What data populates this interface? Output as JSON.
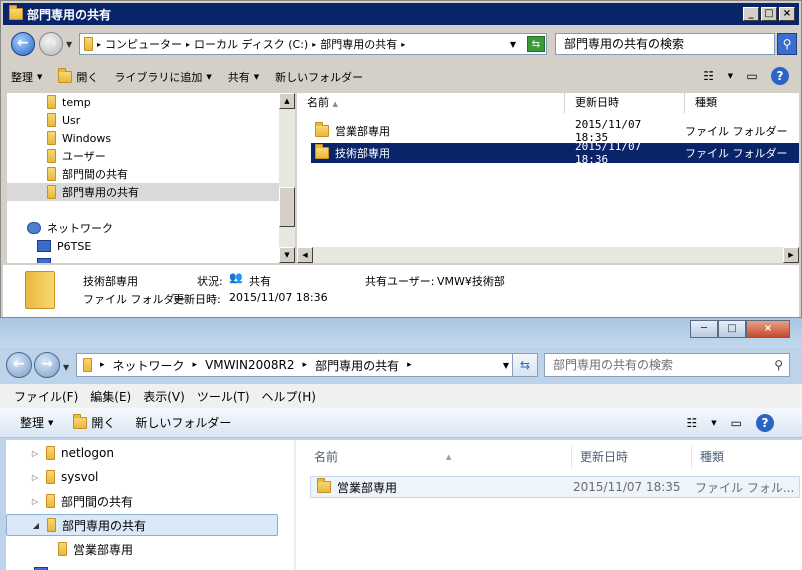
{
  "win1": {
    "title": "部門専用の共有",
    "controls": [
      "_",
      "□",
      "×"
    ],
    "address": {
      "crumbs": [
        "コンピューター",
        "ローカル ディスク (C:)",
        "部門専用の共有"
      ],
      "search_placeholder": "部門専用の共有の検索"
    },
    "toolbar": {
      "organize": "整理",
      "open": "開く",
      "add_library": "ライブラリに追加",
      "share": "共有",
      "new_folder": "新しいフォルダー"
    },
    "nav": [
      {
        "label": "temp"
      },
      {
        "label": "Usr"
      },
      {
        "label": "Windows"
      },
      {
        "label": "ユーザー"
      },
      {
        "label": "部門間の共有"
      },
      {
        "label": "部門専用の共有"
      },
      {
        "label": "ネットワーク"
      },
      {
        "label": "P6TSE"
      }
    ],
    "columns": [
      "名前",
      "更新日時",
      "種類"
    ],
    "rows": [
      {
        "name": "営業部専用",
        "date": "2015/11/07 18:35",
        "type": "ファイル フォルダー"
      },
      {
        "name": "技術部専用",
        "date": "2015/11/07 18:36",
        "type": "ファイル フォルダー"
      }
    ],
    "details": {
      "name": "技術部専用",
      "type": "ファイル フォルダー",
      "status_label": "状況:",
      "status_value": "共有",
      "shared_label": "共有ユーザー:",
      "shared_value": "VMW¥技術部",
      "date_label": "更新日時:",
      "date_value": "2015/11/07 18:36"
    }
  },
  "win2": {
    "controls": [
      "─",
      "□",
      "×"
    ],
    "address": {
      "crumbs": [
        "ネットワーク",
        "VMWIN2008R2",
        "部門専用の共有"
      ],
      "search_placeholder": "部門専用の共有の検索"
    },
    "menu": [
      "ファイル(F)",
      "編集(E)",
      "表示(V)",
      "ツール(T)",
      "ヘルプ(H)"
    ],
    "toolbar": {
      "organize": "整理",
      "open": "開く",
      "new_folder": "新しいフォルダー"
    },
    "nav": [
      {
        "label": "netlogon"
      },
      {
        "label": "sysvol"
      },
      {
        "label": "部門間の共有"
      },
      {
        "label": "部門専用の共有"
      },
      {
        "label": "営業部専用"
      }
    ],
    "columns": [
      "名前",
      "更新日時",
      "種類"
    ],
    "rows": [
      {
        "name": "営業部専用",
        "date": "2015/11/07 18:35",
        "type": "ファイル フォル..."
      }
    ]
  },
  "colors": {
    "xp_title": "#0a246a",
    "selection": "#0a246a",
    "win7_frame": "#bcd3ea"
  }
}
